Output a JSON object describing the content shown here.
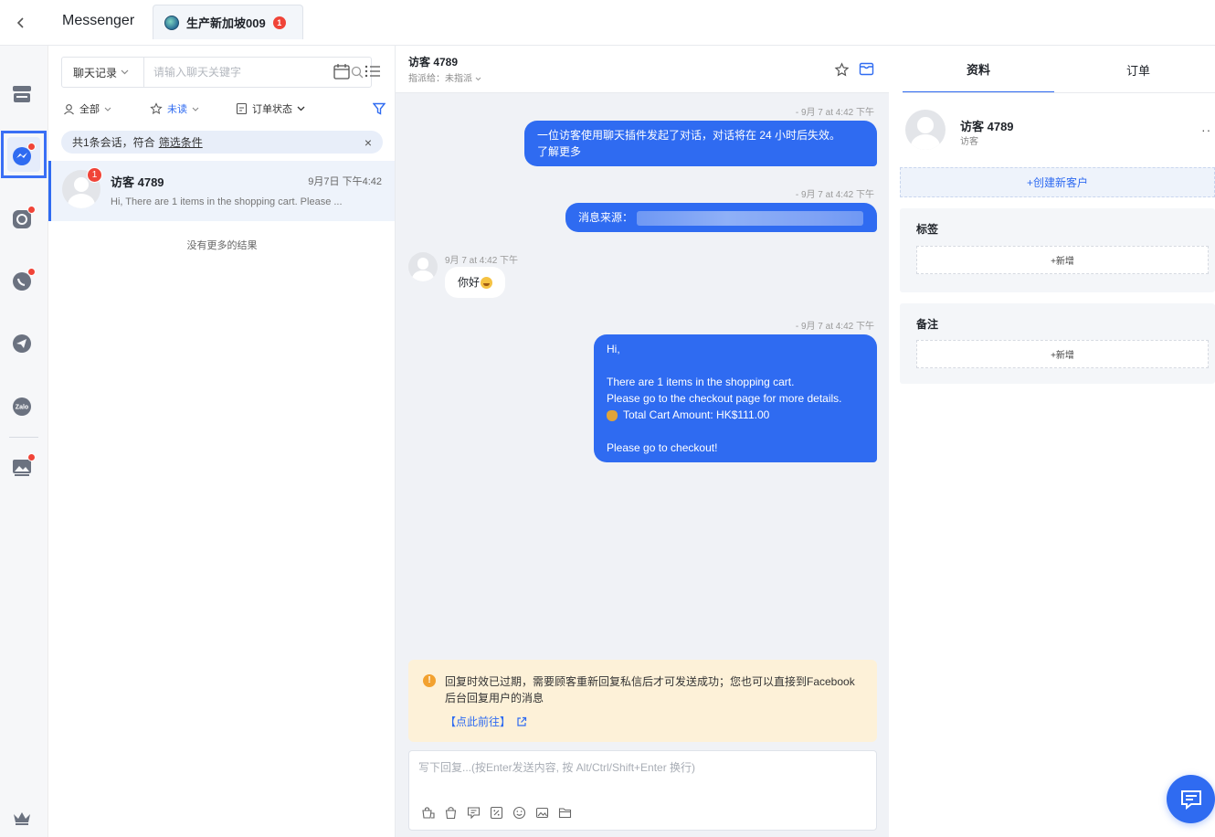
{
  "header": {
    "title": "Messenger",
    "account_tab": "生产新加坡009",
    "account_badge": "1"
  },
  "conversations": {
    "search": {
      "scope": "聊天记录",
      "placeholder": "请输入聊天关键字"
    },
    "filters": {
      "assignee": "全部",
      "read_status": "未读",
      "order_status": "订单状态"
    },
    "notice": {
      "text": "共1条会话，符合",
      "link": "筛选条件",
      "close": "×"
    },
    "items": [
      {
        "name": "访客 4789",
        "time": "9月7日 下午4:42",
        "unread": "1",
        "preview": "Hi, There are 1 items in the shopping cart. Please ..."
      }
    ],
    "no_more": "没有更多的结果"
  },
  "chat": {
    "title": "访客 4789",
    "assign": "指派给：未指派",
    "messages": {
      "t1": "- 9月 7 at 4:42 下午",
      "m1": "一位访客使用聊天插件发起了对话，对话将在 24 小时后失效。",
      "m1_link": "了解更多",
      "t2": "- 9月 7 at 4:42 下午",
      "m2": "消息来源：",
      "t3": "9月 7 at 4:42 下午",
      "m3": "你好",
      "t4": "- 9月 7 at 4:42 下午",
      "m4_l1": "Hi,",
      "m4_l2": "There are 1 items in the shopping cart.",
      "m4_l3": "Please go to the checkout page for more details.",
      "m4_l4": "Total Cart Amount: HK$111.00",
      "m4_l5": "Please go to checkout!"
    },
    "warning": {
      "text": "回复时效已过期，需要顾客重新回复私信后才可发送成功；您也可以直接到Facebook后台回复用户的消息",
      "link": "【点此前往】"
    },
    "reply_placeholder": "写下回复...(按Enter发送内容, 按 Alt/Ctrl/Shift+Enter 换行)"
  },
  "profile": {
    "tabs": [
      "资料",
      "订单"
    ],
    "name": "访客 4789",
    "role": "访客",
    "more": "··",
    "create_customer": "+创建新客户",
    "tags": {
      "title": "标签",
      "add": "+新增"
    },
    "notes": {
      "title": "备注",
      "add": "+新增"
    }
  },
  "colors": {
    "accent": "#2f6bf1",
    "badge": "#f04438",
    "warning_bg": "#fdf1d8"
  }
}
